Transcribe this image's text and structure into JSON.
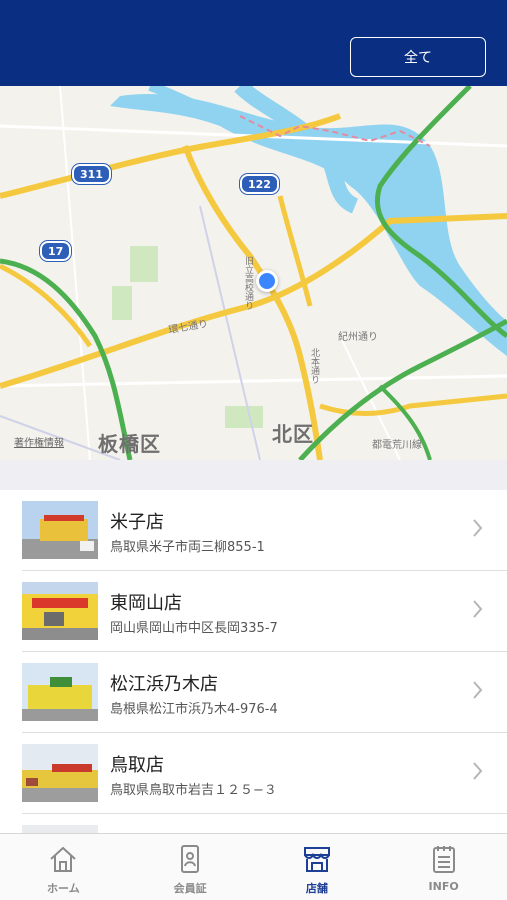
{
  "header": {
    "filter_label": "全て"
  },
  "map": {
    "labels": {
      "itabashi": "板橋区",
      "kita": "北区",
      "kanana": "環七通り",
      "kishu": "紀州通り",
      "toden": "都電荒川線",
      "attribution": "著作権情報",
      "hokuhon": "北本通り",
      "kenritsu": "旧立高校通り"
    },
    "routes": [
      "311",
      "122",
      "17"
    ]
  },
  "stores": [
    {
      "name": "米子店",
      "address": "鳥取県米子市両三柳855-1"
    },
    {
      "name": "東岡山店",
      "address": "岡山県岡山市中区長岡335-7"
    },
    {
      "name": "松江浜乃木店",
      "address": "島根県松江市浜乃木4-976-4"
    },
    {
      "name": "鳥取店",
      "address": "鳥取県鳥取市岩吉１２５−３"
    }
  ],
  "tabs": [
    {
      "label": "ホーム",
      "icon": "home-icon"
    },
    {
      "label": "会員証",
      "icon": "member-card-icon"
    },
    {
      "label": "店舗",
      "icon": "store-icon"
    },
    {
      "label": "INFO",
      "icon": "notepad-icon"
    }
  ],
  "colors": {
    "header": "#0a2f82",
    "active_tab": "#1d3f95",
    "location": "#3a86ff",
    "river": "#8fd3f0",
    "highway": "#f5c93f",
    "green_road": "#4caf50"
  }
}
